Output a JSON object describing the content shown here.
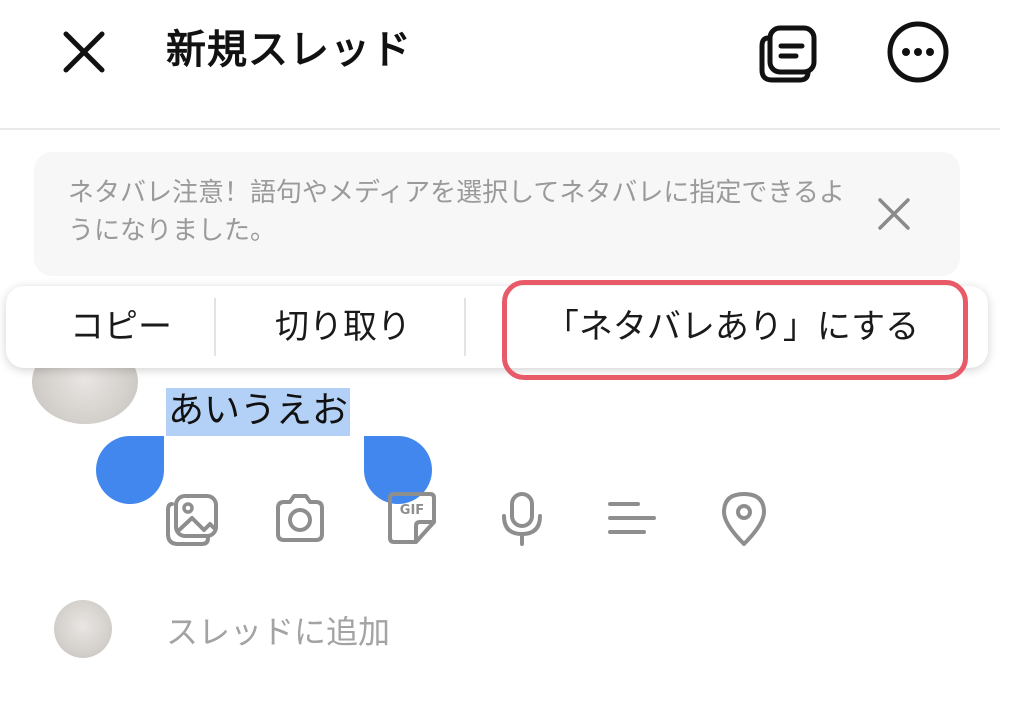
{
  "header": {
    "title": "新規スレッド",
    "close_icon": "close-icon",
    "drafts_icon": "drafts-icon",
    "more_icon": "more-icon"
  },
  "notice": {
    "text": "ネタバレ注意！語句やメディアを選択してネタバレに指定できるようになりました。",
    "close_icon": "close-icon"
  },
  "context_menu": {
    "items": [
      {
        "label": "コピー"
      },
      {
        "label": "切り取り"
      },
      {
        "label": "「ネタバレあり」にする"
      }
    ],
    "highlight_color": "#e85a68"
  },
  "composer": {
    "selected_text": "あいうえお",
    "selection_color": "#b3d0f6",
    "handle_color": "#4287ee",
    "tools": [
      {
        "icon": "image-gallery-icon"
      },
      {
        "icon": "camera-icon"
      },
      {
        "icon": "gif-icon",
        "label": "GIF"
      },
      {
        "icon": "microphone-icon"
      },
      {
        "icon": "text-lines-icon"
      },
      {
        "icon": "location-pin-icon"
      }
    ]
  },
  "add_thread": {
    "placeholder": "スレッドに追加"
  }
}
